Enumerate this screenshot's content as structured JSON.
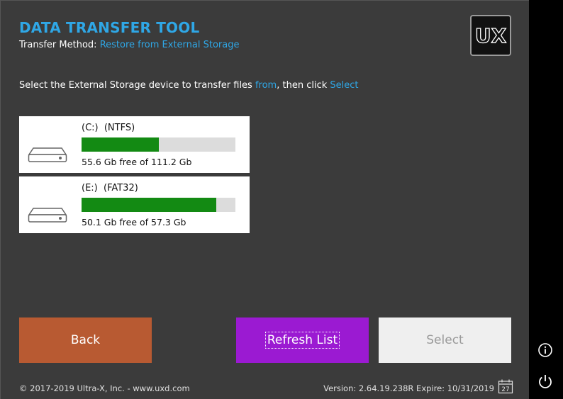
{
  "header": {
    "title": "DATA TRANSFER TOOL",
    "method_label": "Transfer Method:",
    "method_value": "Restore from External Storage",
    "logo_text": "UX"
  },
  "instruction": {
    "prefix": "Select the External Storage device to transfer files",
    "from": "from",
    "middle": ", then click",
    "select": "Select"
  },
  "drives": [
    {
      "name": "(C:)  (NTFS)",
      "free_text": "55.6 Gb free of 111.2 Gb",
      "used_fraction": 0.5
    },
    {
      "name": "(E:)  (FAT32)",
      "free_text": "50.1 Gb free of 57.3 Gb",
      "used_fraction": 0.874
    }
  ],
  "buttons": {
    "back": "Back",
    "refresh": "Refresh List",
    "select": "Select"
  },
  "footer": {
    "copyright": "© 2017-2019 Ultra-X, Inc. - www.uxd.com",
    "version": "Version: 2.64.19.238R Expire: 10/31/2019",
    "calendar_day": "27"
  },
  "icons": {
    "drive": "hard-drive-icon",
    "info": "info-icon",
    "power": "power-icon",
    "calendar": "calendar-icon"
  },
  "colors": {
    "accent": "#2fa7e6",
    "back": "#b85a32",
    "refresh": "#9b1ad2",
    "select_disabled": "#efefef",
    "bar_fill": "#138a13"
  }
}
